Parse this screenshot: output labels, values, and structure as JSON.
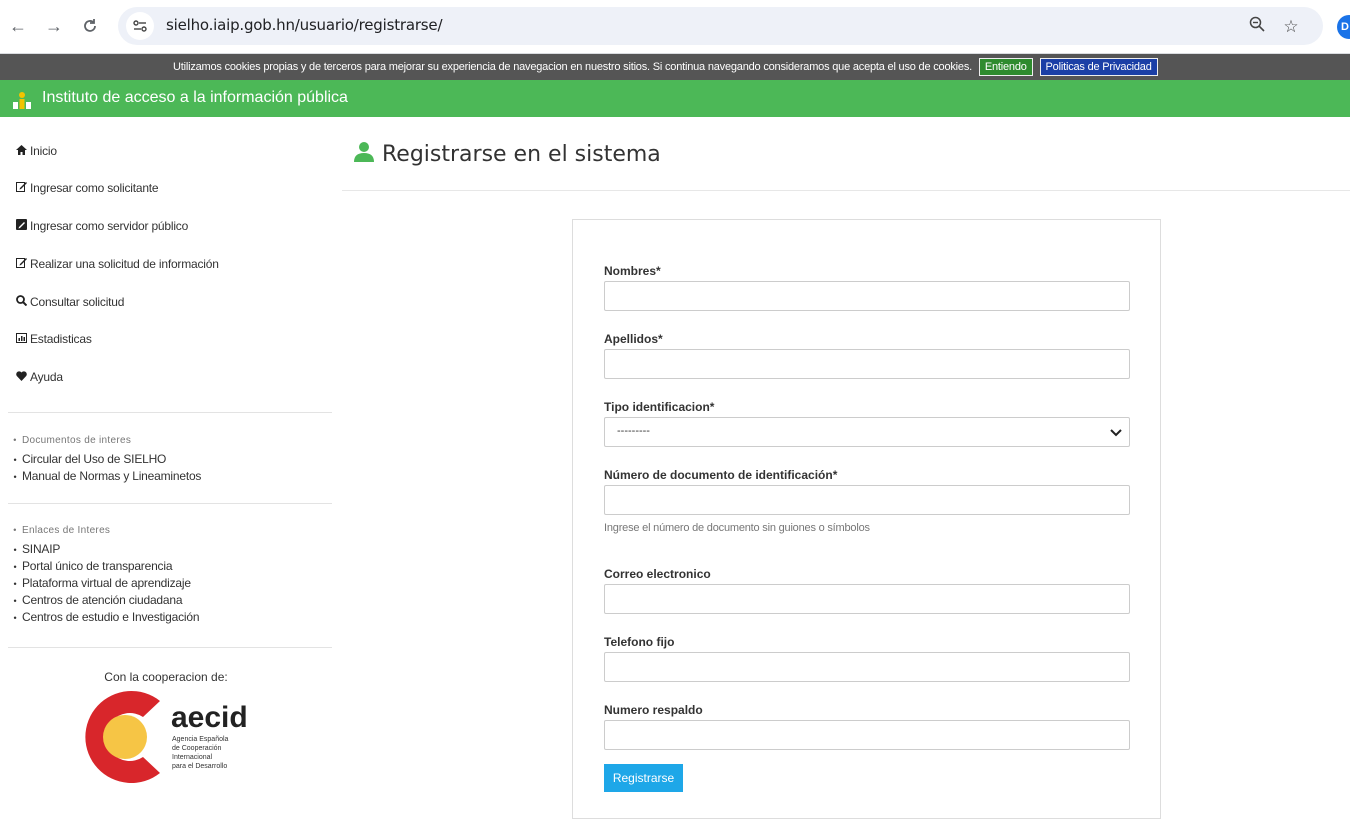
{
  "browser": {
    "url": "sielho.iaip.gob.hn/usuario/registrarse/",
    "profile_initial": "D",
    "icons": [
      "back-arrow-icon",
      "forward-arrow-icon",
      "reload-icon",
      "site-info-icon",
      "zoom-icon",
      "star-icon"
    ]
  },
  "cookie_bar": {
    "message": "Utilizamos cookies propias y de terceros para mejorar su experiencia de navegacion en nuestro sitios. Si continua navegando consideramos que acepta el uso de cookies.",
    "accept_label": "Entiendo",
    "privacy_label": "Politicas de Privacidad"
  },
  "header": {
    "title": "Instituto de acceso a la información pública",
    "color": "#4cb857"
  },
  "sidebar": {
    "menu": [
      {
        "icon": "home-icon",
        "label": "Inicio"
      },
      {
        "icon": "edit-icon",
        "label": "Ingresar como solicitante"
      },
      {
        "icon": "edit-square-icon",
        "label": "Ingresar como servidor público"
      },
      {
        "icon": "edit-icon",
        "label": "Realizar una solicitud de información"
      },
      {
        "icon": "search-icon",
        "label": "Consultar solicitud"
      },
      {
        "icon": "chart-icon",
        "label": "Estadisticas"
      },
      {
        "icon": "heart-icon",
        "label": "Ayuda"
      }
    ],
    "documents": {
      "heading": "Documentos de interes",
      "items": [
        "Circular del Uso de SIELHO",
        "Manual de Normas y Lineaminetos"
      ]
    },
    "links": {
      "heading": "Enlaces de Interes",
      "items": [
        "SINAIP",
        "Portal único de transparencia",
        "Plataforma virtual de aprendizaje",
        "Centros de atención ciudadana",
        "Centros de estudio e Investigación"
      ]
    },
    "cooperation_label": "Con la cooperacion de:",
    "logo": {
      "name": "aecid",
      "lines": [
        "Agencia Española",
        "de Cooperación",
        "Internacional",
        "para el Desarrollo"
      ]
    }
  },
  "main": {
    "title": "Registrarse en el sistema",
    "form": {
      "nombres_label": "Nombres*",
      "apellidos_label": "Apellidos*",
      "tipo_label": "Tipo identificacion*",
      "tipo_value": "---------",
      "numero_label": "Número de documento de identificación*",
      "numero_help": "Ingrese el número de documento sin guiones o símbolos",
      "correo_label": "Correo electronico",
      "telefono_label": "Telefono fijo",
      "respaldo_label": "Numero respaldo",
      "submit_label": "Registrarse"
    }
  },
  "colors": {
    "accent_green": "#4cb857",
    "button_blue": "#1ea7e8",
    "cookie_bg": "#555555",
    "entiendo_green": "#2e8b2e",
    "privacy_blue": "#1b3fa6"
  }
}
